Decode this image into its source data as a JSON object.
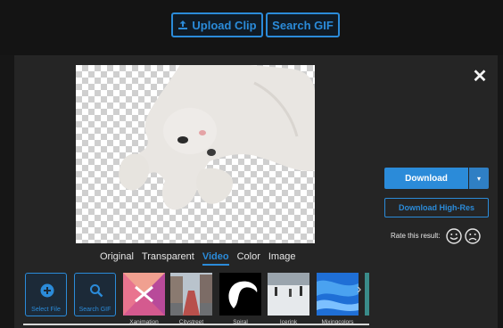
{
  "header": {
    "upload_label": "Upload Clip",
    "search_label": "Search GIF"
  },
  "editor": {
    "tabs": [
      "Original",
      "Transparent",
      "Video",
      "Color",
      "Image"
    ],
    "active_tab": "Video",
    "tools": [
      {
        "label": "Select File",
        "icon": "plus-circle-icon"
      },
      {
        "label": "Search GIF",
        "icon": "search-icon"
      }
    ],
    "thumbnails": [
      {
        "label": "Xanimation"
      },
      {
        "label": "Citystreet"
      },
      {
        "label": "Spiral"
      },
      {
        "label": "Icerink"
      },
      {
        "label": "Mixingcolors"
      }
    ]
  },
  "actions": {
    "download_label": "Download",
    "download_hires_label": "Download High-Res",
    "rate_label": "Rate this result:"
  },
  "colors": {
    "accent": "#2b8bd9",
    "background": "#161616",
    "panel": "#252525"
  }
}
